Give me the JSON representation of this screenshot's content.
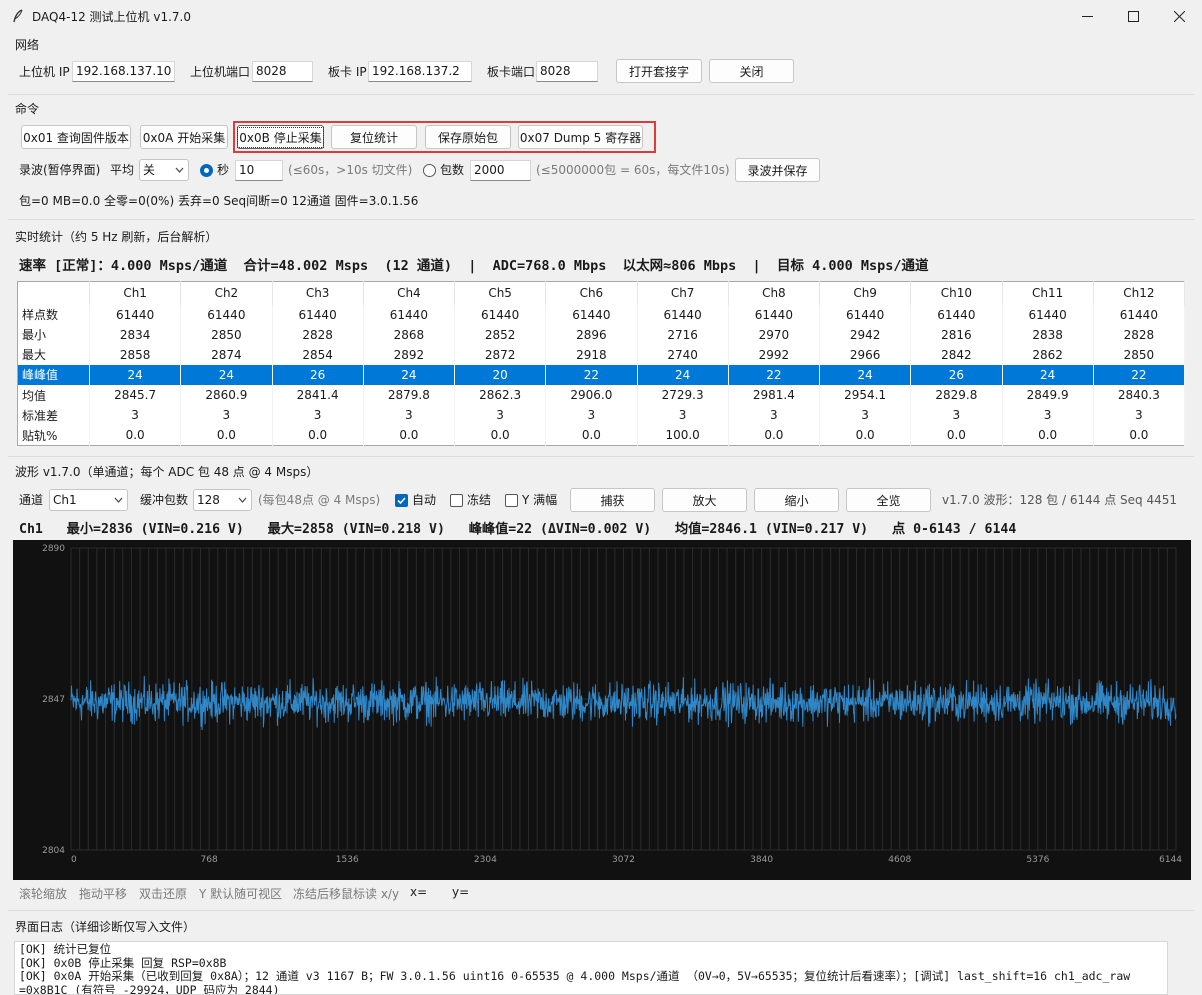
{
  "window": {
    "title": "DAQ4-12 测试上位机 v1.7.0",
    "minimize_icon": "minimize-icon",
    "maximize_icon": "maximize-icon",
    "close_icon": "close-icon"
  },
  "network": {
    "section": "网络",
    "host_ip_label": "上位机 IP",
    "host_ip": "192.168.137.10",
    "host_port_label": "上位机端口",
    "host_port": "8028",
    "board_ip_label": "板卡 IP",
    "board_ip": "192.168.137.2",
    "board_port_label": "板卡端口",
    "board_port": "8028",
    "open_socket": "打开套接字",
    "close": "关闭"
  },
  "commands": {
    "section": "命令",
    "buttons": [
      "0x01 查询固件版本",
      "0x0A 开始采集",
      "0x0B 停止采集",
      "复位统计",
      "保存原始包",
      "0x07 Dump 5 寄存器"
    ],
    "highlight_color": "#e03b3b"
  },
  "record": {
    "label": "录波(暂停界面)",
    "avg_label": "平均",
    "avg_value": "关",
    "sec_label": "秒",
    "sec_value": "10",
    "sec_hint": "(≤60s，>10s 切文件)",
    "pkt_label": "包数",
    "pkt_value": "2000",
    "pkt_hint": "(≤5000000包 = 60s，每文件10s)",
    "record_save": "录波并保存"
  },
  "status_line": "包=0  MB=0.0  全零=0(0%)  丢弃=0  Seq间断=0  12通道  固件=3.0.1.56",
  "realtime": {
    "section": "实时统计（约 5 Hz 刷新，后台解析）",
    "summary": "速率 [正常]：4.000 Msps/通道  合计=48.002 Msps  (12 通道)  |  ADC=768.0 Mbps  以太网≈806 Mbps  |  目标 4.000 Msps/通道"
  },
  "table": {
    "columns": [
      "",
      "Ch1",
      "Ch2",
      "Ch3",
      "Ch4",
      "Ch5",
      "Ch6",
      "Ch7",
      "Ch8",
      "Ch9",
      "Ch10",
      "Ch11",
      "Ch12"
    ],
    "rows": [
      [
        "样点数",
        "61440",
        "61440",
        "61440",
        "61440",
        "61440",
        "61440",
        "61440",
        "61440",
        "61440",
        "61440",
        "61440",
        "61440"
      ],
      [
        "最小",
        "2834",
        "2850",
        "2828",
        "2868",
        "2852",
        "2896",
        "2716",
        "2970",
        "2942",
        "2816",
        "2838",
        "2828"
      ],
      [
        "最大",
        "2858",
        "2874",
        "2854",
        "2892",
        "2872",
        "2918",
        "2740",
        "2992",
        "2966",
        "2842",
        "2862",
        "2850"
      ],
      [
        "峰峰值",
        "24",
        "24",
        "26",
        "24",
        "20",
        "22",
        "24",
        "22",
        "24",
        "26",
        "24",
        "22"
      ],
      [
        "均值",
        "2845.7",
        "2860.9",
        "2841.4",
        "2879.8",
        "2862.3",
        "2906.0",
        "2729.3",
        "2981.4",
        "2954.1",
        "2829.8",
        "2849.9",
        "2840.3"
      ],
      [
        "标准差",
        "3",
        "3",
        "3",
        "3",
        "3",
        "3",
        "3",
        "3",
        "3",
        "3",
        "3",
        "3"
      ],
      [
        "贴轨%",
        "0.0",
        "0.0",
        "0.0",
        "0.0",
        "0.0",
        "0.0",
        "100.0",
        "0.0",
        "0.0",
        "0.0",
        "0.0",
        "0.0"
      ]
    ],
    "selected_row": 3,
    "selection_color": "#0078d7"
  },
  "waveform": {
    "section": "波形 v1.7.0（单通道；每个 ADC 包 48 点 @ 4 Msps）",
    "channel_label": "通道",
    "channel_value": "Ch1",
    "buffer_label": "缓冲包数",
    "buffer_value": "128",
    "buffer_hint": "(每包48点 @ 4 Msps)",
    "auto": "自动",
    "freeze": "冻结",
    "yfull": "Y 满幅",
    "capture": "捕获",
    "zoom_in": "放大",
    "zoom_out": "缩小",
    "overview": "全览",
    "info": "v1.7.0  波形：128 包 / 6144 点  Seq 4451",
    "readout": "Ch1   最小=2836 (VIN=0.216 V)   最大=2858 (VIN=0.218 V)   峰峰值=22 (ΔVIN=0.002 V)   均值=2846.1 (VIN=0.217 V)   点 0-6143 / 6144"
  },
  "chart_data": {
    "type": "line",
    "series": [
      {
        "name": "Ch1",
        "n_points": 6144,
        "min": 2836,
        "max": 2858,
        "mean": 2846.1
      }
    ],
    "xlim": [
      0,
      6144
    ],
    "ylim": [
      2804,
      2890
    ],
    "xticks": [
      "0",
      "768",
      "1536",
      "2304",
      "3072",
      "3840",
      "4608",
      "5376",
      "6144"
    ],
    "yticks": [
      "2890",
      "2847",
      "2804"
    ],
    "background": "#111111",
    "line_color": "#2f87c8",
    "grid": true
  },
  "plot_hints": {
    "wheel": "滚轮缩放",
    "drag": "拖动平移",
    "dbl": "双击还原",
    "ydefault": "Y 默认随可视区",
    "freeze_read": "冻结后移鼠标读 x/y",
    "x_label": "x=",
    "y_label": "y="
  },
  "log": {
    "section": "界面日志（详细诊断仅写入文件）",
    "lines": [
      "[OK] 统计已复位",
      "[OK] 0x0B 停止采集 回复 RSP=0x8B",
      "[OK] 0x0A 开始采集（已收到回复 0x8A）；12 通道 v3 1167 B；FW 3.0.1.56 uint16 0-65535 @ 4.000 Msps/通道 （0V→0，5V→65535；复位统计后看速率）；[调试] last_shift=16 ch1_adc_raw",
      "=0x8B1C (有符号 -29924，UDP 码应为 2844)"
    ]
  }
}
